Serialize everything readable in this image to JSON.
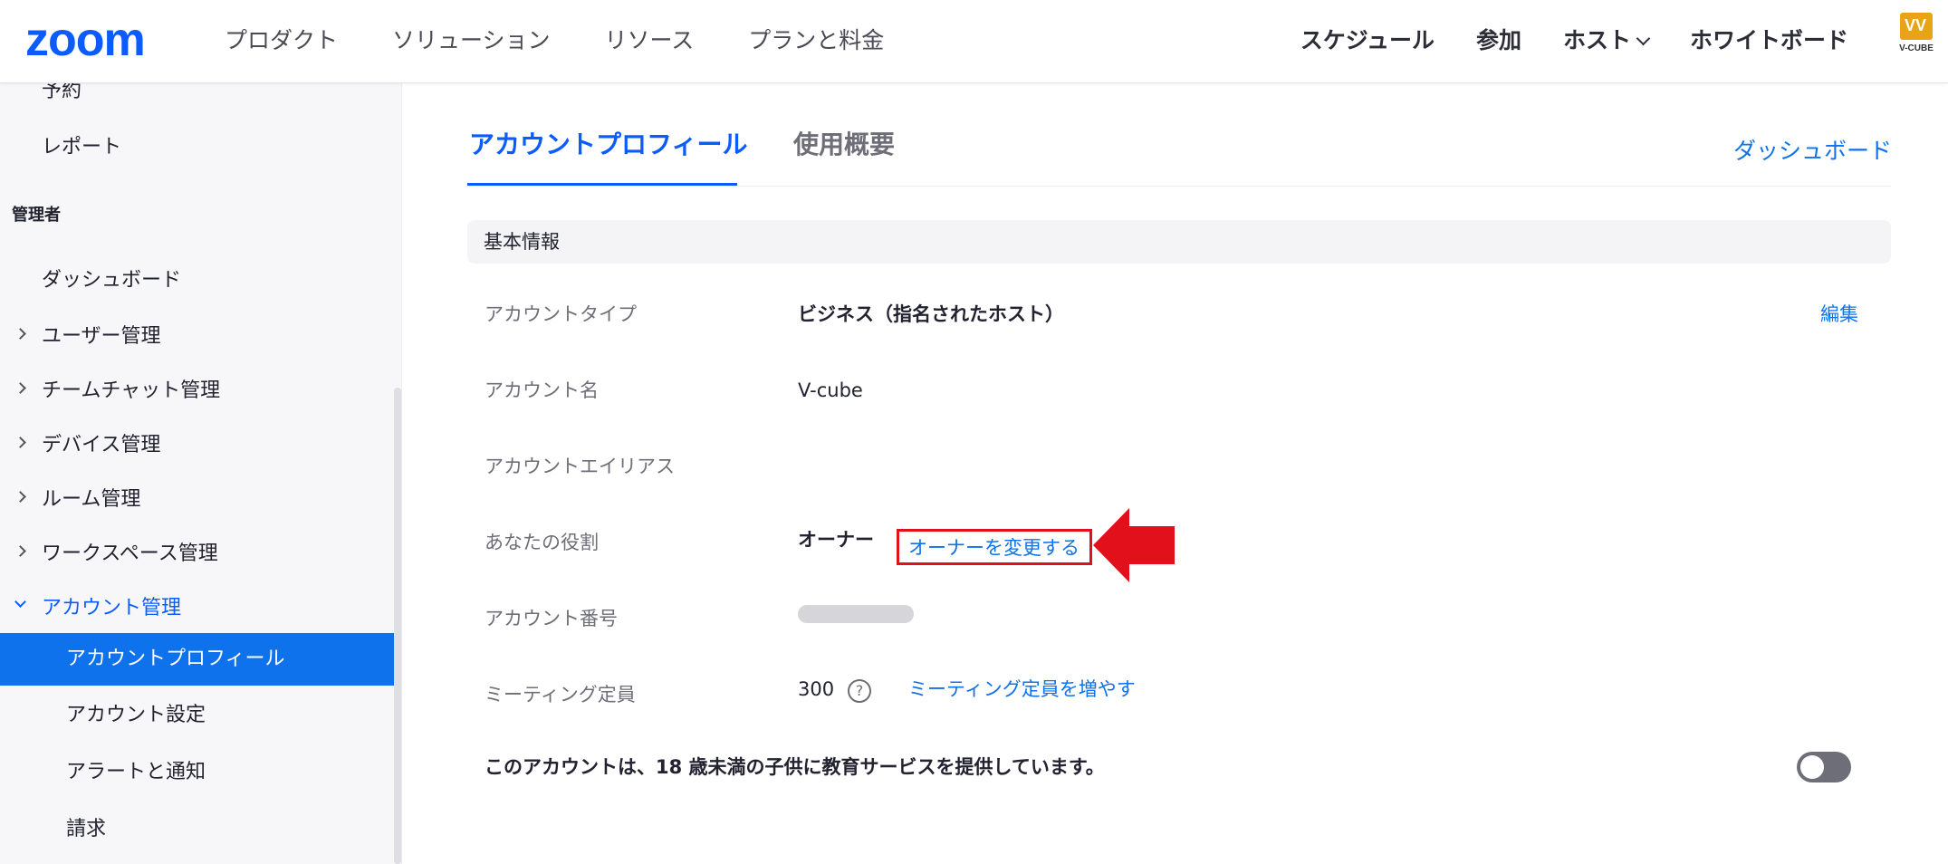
{
  "header": {
    "logo": "zoom",
    "nav_left": [
      "プロダクト",
      "ソリューション",
      "リソース",
      "プランと料金"
    ],
    "nav_right": {
      "schedule": "スケジュール",
      "join": "参加",
      "host": "ホスト",
      "whiteboard": "ホワイトボード"
    },
    "brand": {
      "mark": "VV",
      "text": "V-CUBE"
    }
  },
  "sidebar": {
    "top_items": [
      "予約",
      "レポート"
    ],
    "section_admin": "管理者",
    "dashboard": "ダッシュボード",
    "groups": [
      "ユーザー管理",
      "チームチャット管理",
      "デバイス管理",
      "ルーム管理",
      "ワークスペース管理",
      "アカウント管理"
    ],
    "sub_items": [
      "アカウントプロフィール",
      "アカウント設定",
      "アラートと通知",
      "請求"
    ],
    "active_sub": "アカウントプロフィール"
  },
  "main": {
    "tabs": [
      "アカウントプロフィール",
      "使用概要"
    ],
    "active_tab": "アカウントプロフィール",
    "dashboard_link": "ダッシュボード",
    "section_title": "基本情報",
    "rows": {
      "account_type": {
        "label": "アカウントタイプ",
        "value": "ビジネス（指名されたホスト）",
        "action": "編集"
      },
      "account_name": {
        "label": "アカウント名",
        "value": "V-cube"
      },
      "account_alias": {
        "label": "アカウントエイリアス",
        "value": ""
      },
      "role": {
        "label": "あなたの役割",
        "value": "オーナー",
        "action": "オーナーを変更する"
      },
      "account_number": {
        "label": "アカウント番号"
      },
      "capacity": {
        "label": "ミーティング定員",
        "value": "300",
        "help": "?",
        "action": "ミーティング定員を増やす"
      }
    },
    "education_notice": "このアカウントは、18 歳未満の子供に教育サービスを提供しています。",
    "education_toggle": false
  },
  "colors": {
    "brand_blue": "#0b5cff",
    "link_blue": "#0e72ed",
    "active_sidebar_bg": "#0e72ed",
    "highlight_red": "#e1101a"
  }
}
